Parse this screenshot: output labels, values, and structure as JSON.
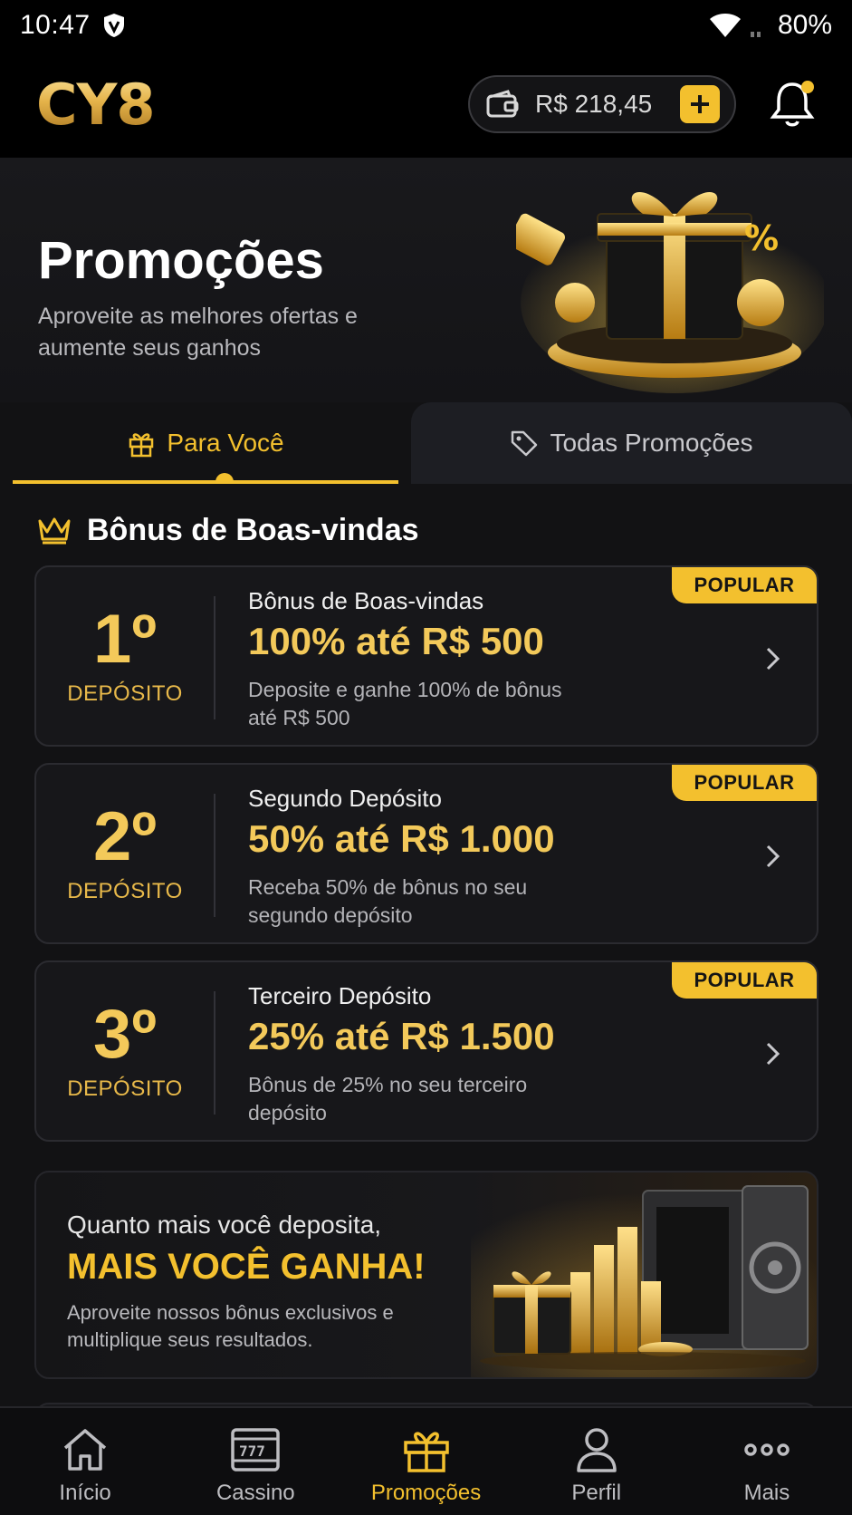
{
  "status_bar": {
    "time": "10:47",
    "battery": "80%"
  },
  "header": {
    "logo": "CY8",
    "balance": "R$ 218,45"
  },
  "hero": {
    "title": "Promoções",
    "subtitle": "Aproveite as melhores ofertas e aumente seus ganhos"
  },
  "tabs": [
    {
      "label": "Para Você",
      "active": true
    },
    {
      "label": "Todas Promoções",
      "active": false
    }
  ],
  "section": {
    "title": "Bônus de Boas-vindas"
  },
  "cards": [
    {
      "rank": "1º",
      "rank_label": "DEPÓSITO",
      "badge": "POPULAR",
      "title": "Bônus de Boas-vindas",
      "offer": "100% até R$ 500",
      "description": "Deposite e ganhe 100% de bônus até R$ 500"
    },
    {
      "rank": "2º",
      "rank_label": "DEPÓSITO",
      "badge": "POPULAR",
      "title": "Segundo Depósito",
      "offer": "50% até R$ 1.000",
      "description": "Receba 50% de bônus no seu segundo depósito"
    },
    {
      "rank": "3º",
      "rank_label": "DEPÓSITO",
      "badge": "POPULAR",
      "title": "Terceiro Depósito",
      "offer": "25% até R$ 1.500",
      "description": "Bônus de 25% no seu terceiro depósito"
    }
  ],
  "banner": {
    "line1": "Quanto mais você deposita,",
    "line2": "MAIS VOCÊ GANHA!",
    "line3": "Aproveite nossos bônus exclusivos e multiplique seus resultados."
  },
  "bottom_nav": [
    {
      "label": "Início",
      "icon": "home-icon",
      "active": false
    },
    {
      "label": "Cassino",
      "icon": "slot-machine-icon",
      "active": false
    },
    {
      "label": "Promoções",
      "icon": "gift-icon",
      "active": true
    },
    {
      "label": "Perfil",
      "icon": "user-icon",
      "active": false
    },
    {
      "label": "Mais",
      "icon": "more-icon",
      "active": false
    }
  ],
  "colors": {
    "accent": "#f3c02e",
    "gold_text": "#f3c95a",
    "background": "#121214",
    "card": "#17171a"
  }
}
